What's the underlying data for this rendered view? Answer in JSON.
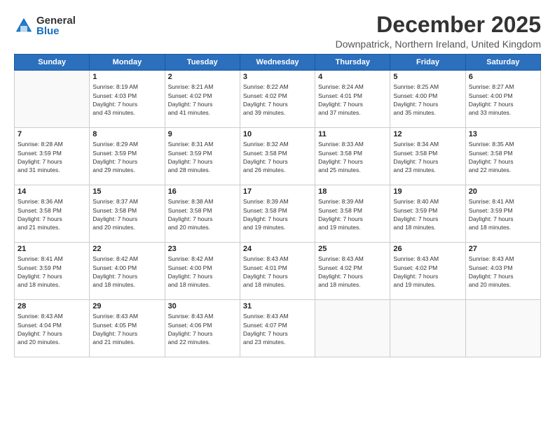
{
  "logo": {
    "general": "General",
    "blue": "Blue"
  },
  "title": "December 2025",
  "subtitle": "Downpatrick, Northern Ireland, United Kingdom",
  "weekdays": [
    "Sunday",
    "Monday",
    "Tuesday",
    "Wednesday",
    "Thursday",
    "Friday",
    "Saturday"
  ],
  "weeks": [
    [
      {
        "day": "",
        "info": ""
      },
      {
        "day": "1",
        "info": "Sunrise: 8:19 AM\nSunset: 4:03 PM\nDaylight: 7 hours\nand 43 minutes."
      },
      {
        "day": "2",
        "info": "Sunrise: 8:21 AM\nSunset: 4:02 PM\nDaylight: 7 hours\nand 41 minutes."
      },
      {
        "day": "3",
        "info": "Sunrise: 8:22 AM\nSunset: 4:02 PM\nDaylight: 7 hours\nand 39 minutes."
      },
      {
        "day": "4",
        "info": "Sunrise: 8:24 AM\nSunset: 4:01 PM\nDaylight: 7 hours\nand 37 minutes."
      },
      {
        "day": "5",
        "info": "Sunrise: 8:25 AM\nSunset: 4:00 PM\nDaylight: 7 hours\nand 35 minutes."
      },
      {
        "day": "6",
        "info": "Sunrise: 8:27 AM\nSunset: 4:00 PM\nDaylight: 7 hours\nand 33 minutes."
      }
    ],
    [
      {
        "day": "7",
        "info": "Sunrise: 8:28 AM\nSunset: 3:59 PM\nDaylight: 7 hours\nand 31 minutes."
      },
      {
        "day": "8",
        "info": "Sunrise: 8:29 AM\nSunset: 3:59 PM\nDaylight: 7 hours\nand 29 minutes."
      },
      {
        "day": "9",
        "info": "Sunrise: 8:31 AM\nSunset: 3:59 PM\nDaylight: 7 hours\nand 28 minutes."
      },
      {
        "day": "10",
        "info": "Sunrise: 8:32 AM\nSunset: 3:58 PM\nDaylight: 7 hours\nand 26 minutes."
      },
      {
        "day": "11",
        "info": "Sunrise: 8:33 AM\nSunset: 3:58 PM\nDaylight: 7 hours\nand 25 minutes."
      },
      {
        "day": "12",
        "info": "Sunrise: 8:34 AM\nSunset: 3:58 PM\nDaylight: 7 hours\nand 23 minutes."
      },
      {
        "day": "13",
        "info": "Sunrise: 8:35 AM\nSunset: 3:58 PM\nDaylight: 7 hours\nand 22 minutes."
      }
    ],
    [
      {
        "day": "14",
        "info": "Sunrise: 8:36 AM\nSunset: 3:58 PM\nDaylight: 7 hours\nand 21 minutes."
      },
      {
        "day": "15",
        "info": "Sunrise: 8:37 AM\nSunset: 3:58 PM\nDaylight: 7 hours\nand 20 minutes."
      },
      {
        "day": "16",
        "info": "Sunrise: 8:38 AM\nSunset: 3:58 PM\nDaylight: 7 hours\nand 20 minutes."
      },
      {
        "day": "17",
        "info": "Sunrise: 8:39 AM\nSunset: 3:58 PM\nDaylight: 7 hours\nand 19 minutes."
      },
      {
        "day": "18",
        "info": "Sunrise: 8:39 AM\nSunset: 3:58 PM\nDaylight: 7 hours\nand 19 minutes."
      },
      {
        "day": "19",
        "info": "Sunrise: 8:40 AM\nSunset: 3:59 PM\nDaylight: 7 hours\nand 18 minutes."
      },
      {
        "day": "20",
        "info": "Sunrise: 8:41 AM\nSunset: 3:59 PM\nDaylight: 7 hours\nand 18 minutes."
      }
    ],
    [
      {
        "day": "21",
        "info": "Sunrise: 8:41 AM\nSunset: 3:59 PM\nDaylight: 7 hours\nand 18 minutes."
      },
      {
        "day": "22",
        "info": "Sunrise: 8:42 AM\nSunset: 4:00 PM\nDaylight: 7 hours\nand 18 minutes."
      },
      {
        "day": "23",
        "info": "Sunrise: 8:42 AM\nSunset: 4:00 PM\nDaylight: 7 hours\nand 18 minutes."
      },
      {
        "day": "24",
        "info": "Sunrise: 8:43 AM\nSunset: 4:01 PM\nDaylight: 7 hours\nand 18 minutes."
      },
      {
        "day": "25",
        "info": "Sunrise: 8:43 AM\nSunset: 4:02 PM\nDaylight: 7 hours\nand 18 minutes."
      },
      {
        "day": "26",
        "info": "Sunrise: 8:43 AM\nSunset: 4:02 PM\nDaylight: 7 hours\nand 19 minutes."
      },
      {
        "day": "27",
        "info": "Sunrise: 8:43 AM\nSunset: 4:03 PM\nDaylight: 7 hours\nand 20 minutes."
      }
    ],
    [
      {
        "day": "28",
        "info": "Sunrise: 8:43 AM\nSunset: 4:04 PM\nDaylight: 7 hours\nand 20 minutes."
      },
      {
        "day": "29",
        "info": "Sunrise: 8:43 AM\nSunset: 4:05 PM\nDaylight: 7 hours\nand 21 minutes."
      },
      {
        "day": "30",
        "info": "Sunrise: 8:43 AM\nSunset: 4:06 PM\nDaylight: 7 hours\nand 22 minutes."
      },
      {
        "day": "31",
        "info": "Sunrise: 8:43 AM\nSunset: 4:07 PM\nDaylight: 7 hours\nand 23 minutes."
      },
      {
        "day": "",
        "info": ""
      },
      {
        "day": "",
        "info": ""
      },
      {
        "day": "",
        "info": ""
      }
    ]
  ]
}
